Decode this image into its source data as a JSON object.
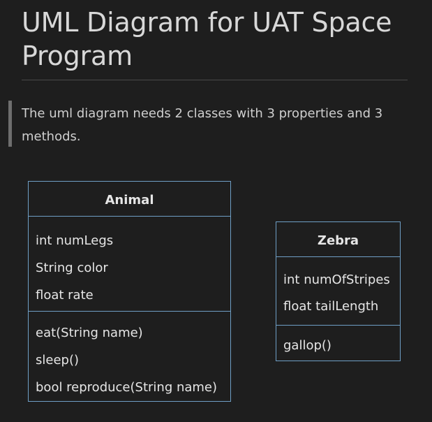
{
  "heading": "UML Diagram for UAT Space Program",
  "blockquote": "The uml diagram needs 2 classes with 3 properties and 3 methods.",
  "classes": [
    {
      "name": "Animal",
      "properties": [
        "int numLegs",
        "String color",
        "float rate"
      ],
      "methods": [
        "eat(String name)",
        "sleep()",
        "bool reproduce(String name)"
      ]
    },
    {
      "name": "Zebra",
      "properties": [
        "int numOfStripes",
        "float tailLength"
      ],
      "methods": [
        "gallop()"
      ]
    }
  ],
  "colors": {
    "background": "#1e1e1e",
    "text": "#d4d4d4",
    "class_border": "#6f9fc6",
    "quote_bar": "#6e6e6e",
    "rule": "#4a4a4a"
  }
}
